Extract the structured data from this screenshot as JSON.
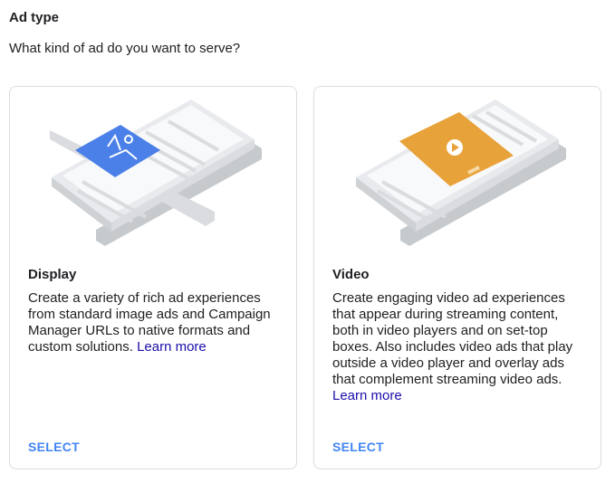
{
  "header": {
    "title": "Ad type",
    "question": "What kind of ad do you want to serve?"
  },
  "cards": [
    {
      "title": "Display",
      "description": "Create a variety of rich ad experiences from standard image ads and Campaign Manager URLs to native formats and custom solutions.",
      "learn_more": "Learn more",
      "select_label": "SELECT",
      "illustration": "phone-with-image-ad-icon",
      "accent_color": "#4a80e8"
    },
    {
      "title": "Video",
      "description": "Create engaging video ad experiences that appear during streaming content, both in video players and on set-top boxes. Also includes video ads that play outside a video player and overlay ads that complement streaming video ads.",
      "learn_more": "Learn more",
      "select_label": "SELECT",
      "illustration": "phone-with-video-ad-icon",
      "accent_color": "#e8a23a"
    }
  ]
}
